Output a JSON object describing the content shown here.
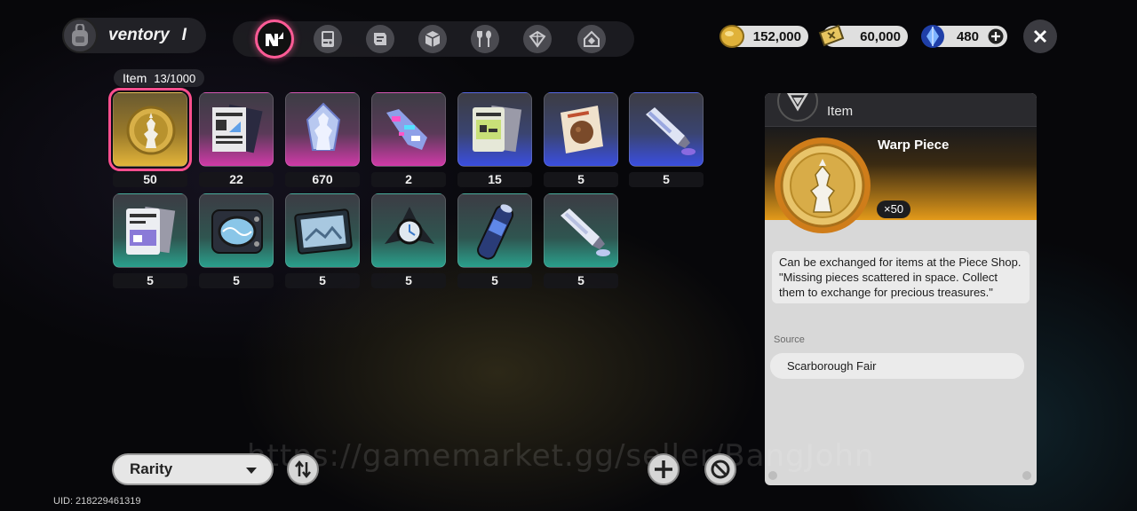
{
  "header": {
    "title": "ventory",
    "title_suffix": "I",
    "tabs": [
      {
        "name": "all",
        "icon": "nexus-icon",
        "active": true
      },
      {
        "name": "device",
        "icon": "handheld-icon",
        "active": false
      },
      {
        "name": "materials",
        "icon": "scroll-icon",
        "active": false
      },
      {
        "name": "items",
        "icon": "cube-icon",
        "active": false
      },
      {
        "name": "food",
        "icon": "fork-spoon-icon",
        "active": false
      },
      {
        "name": "package",
        "icon": "box-icon",
        "active": false
      },
      {
        "name": "furniture",
        "icon": "house-icon",
        "active": false
      }
    ],
    "currencies": [
      {
        "icon": "gold-coin-icon",
        "value": "152,000"
      },
      {
        "icon": "ticket-icon",
        "value": "60,000"
      },
      {
        "icon": "crystal-icon",
        "value": "480"
      }
    ]
  },
  "inventory": {
    "category_label": "Item",
    "count": "13/1000",
    "items": [
      {
        "name": "warp-piece",
        "rarity": "gold",
        "qty": "50"
      },
      {
        "name": "blueprint-doc",
        "rarity": "pink",
        "qty": "22"
      },
      {
        "name": "crystal-pawn",
        "rarity": "pink",
        "qty": "670"
      },
      {
        "name": "glitch-shard",
        "rarity": "pink",
        "qty": "2"
      },
      {
        "name": "data-card",
        "rarity": "blue",
        "qty": "15"
      },
      {
        "name": "snack-pack",
        "rarity": "blue",
        "qty": "5"
      },
      {
        "name": "paint-tube",
        "rarity": "blue",
        "qty": "5"
      },
      {
        "name": "manual-booklet",
        "rarity": "teal",
        "qty": "5"
      },
      {
        "name": "chip-module",
        "rarity": "teal",
        "qty": "5"
      },
      {
        "name": "photo-frame",
        "rarity": "teal",
        "qty": "5"
      },
      {
        "name": "spinner-gadget",
        "rarity": "teal",
        "qty": "5"
      },
      {
        "name": "spray-can",
        "rarity": "teal",
        "qty": "5"
      },
      {
        "name": "cream-tube",
        "rarity": "teal",
        "qty": "5"
      }
    ]
  },
  "detail": {
    "category": "Item",
    "name": "Warp Piece",
    "qty": "×50",
    "description_1": "Can be exchanged for items at the Piece Shop.",
    "description_2": "\"Missing pieces scattered in space. Collect them to exchange for precious treasures.\"",
    "source_label": "Source",
    "source": "Scarborough Fair"
  },
  "footer": {
    "sort_label": "Rarity",
    "watermark": "https://gamemarket.gg/seller/BangJohn",
    "uid": "UID: 218229461319"
  },
  "colors": {
    "accent": "#ff5b96",
    "gold": "#e3b43a",
    "pink": "#d03aa8",
    "blue": "#3a4ee0",
    "teal": "#2aa08c"
  }
}
